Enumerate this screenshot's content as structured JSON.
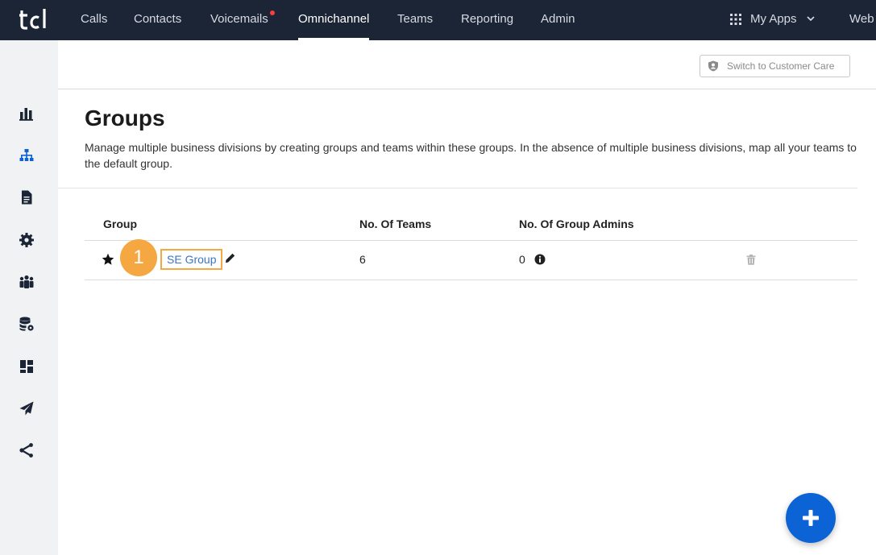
{
  "nav": {
    "logo_text": "tcl",
    "items": [
      {
        "label": "Calls"
      },
      {
        "label": "Contacts"
      },
      {
        "label": "Voicemails"
      },
      {
        "label": "Omnichannel"
      },
      {
        "label": "Teams"
      },
      {
        "label": "Reporting"
      },
      {
        "label": "Admin"
      }
    ],
    "my_apps": "My Apps",
    "web": "Web"
  },
  "sidebar": {
    "icons": [
      "chart-icon",
      "org-chart-icon",
      "document-icon",
      "gear-icon",
      "people-icon",
      "database-settings-icon",
      "dashboard-icon",
      "paper-plane-icon",
      "share-icon"
    ]
  },
  "header": {
    "switch_button": "Switch to Customer Care"
  },
  "page": {
    "title": "Groups",
    "description": "Manage multiple business divisions by creating groups and teams within these groups. In the absence of multiple business divisions, map all your teams to the default group."
  },
  "table": {
    "columns": [
      "Group",
      "No. Of Teams",
      "No. Of Group Admins"
    ],
    "rows": [
      {
        "group": "SE Group",
        "teams": "6",
        "admins": "0"
      }
    ]
  },
  "annotation": {
    "step": "1"
  },
  "colors": {
    "topbar": "#1c2536",
    "accent_orange": "#f5a742",
    "link_blue": "#3b74c6",
    "fab_blue": "#0b63d6",
    "notification": "#ff3b3b"
  }
}
